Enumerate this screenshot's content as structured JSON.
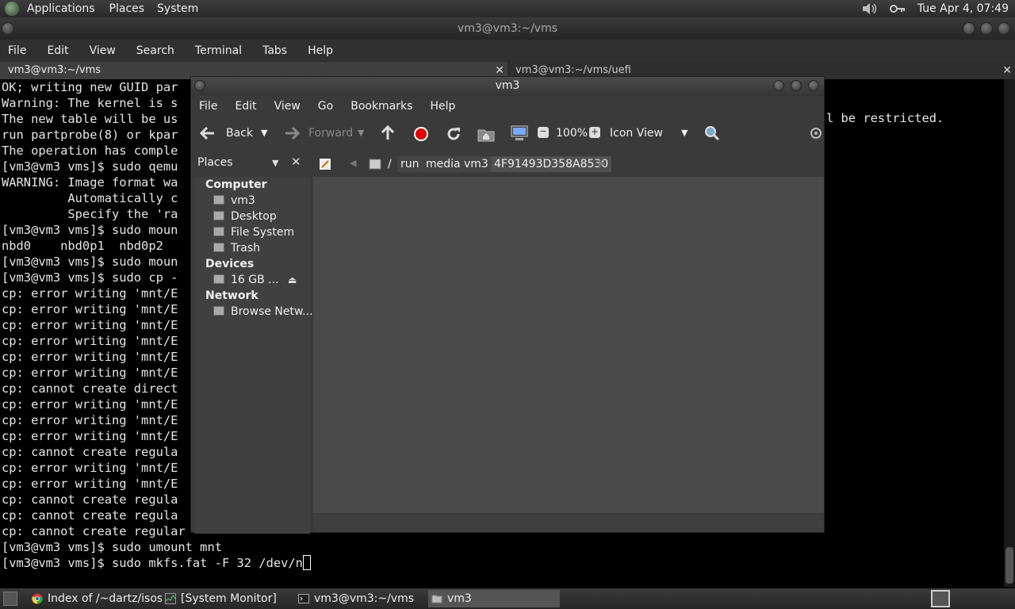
{
  "top_panel": {
    "menus": [
      "Applications",
      "Places",
      "System"
    ],
    "clock": "Tue Apr  4, 07:49"
  },
  "terminal": {
    "title": "vm3@vm3:~/vms",
    "menus": [
      "File",
      "Edit",
      "View",
      "Search",
      "Terminal",
      "Tabs",
      "Help"
    ],
    "tabs": [
      {
        "label": "vm3@vm3:~/vms"
      },
      {
        "label": "vm3@vm3:~/vms/uefi"
      }
    ],
    "lines": [
      "OK; writing new GUID par",
      "Warning: The kernel is s",
      "The new table will be us",
      "run partprobe(8) or kpar",
      "The operation has comple",
      "[vm3@vm3 vms]$ sudo qemu",
      "WARNING: Image format wa",
      "         Automatically c",
      "         Specify the 'ra",
      "[vm3@vm3 vms]$ sudo moun",
      "nbd0    nbd0p1  nbd0p2",
      "[vm3@vm3 vms]$ sudo moun",
      "[vm3@vm3 vms]$ sudo cp -",
      "cp: error writing 'mnt/E",
      "cp: error writing 'mnt/E",
      "cp: error writing 'mnt/E",
      "cp: error writing 'mnt/E",
      "cp: error writing 'mnt/E",
      "cp: error writing 'mnt/E",
      "cp: cannot create direct",
      "cp: error writing 'mnt/E",
      "cp: error writing 'mnt/E",
      "cp: error writing 'mnt/E",
      "cp: cannot create regula",
      "cp: error writing 'mnt/E",
      "cp: error writing 'mnt/E",
      "cp: cannot create regula",
      "cp: cannot create regula",
      "cp: cannot create regular",
      "[vm3@vm3 vms]$ sudo umount mnt",
      "[vm3@vm3 vms]$ sudo mkfs.fat -F 32 /dev/n"
    ],
    "restricted_fragment": "l be restricted."
  },
  "file_manager": {
    "title": "vm3",
    "menus": [
      "File",
      "Edit",
      "View",
      "Go",
      "Bookmarks",
      "Help"
    ],
    "toolbar": {
      "back": "Back",
      "forward": "Forward",
      "zoom": "100%",
      "view_mode": "Icon View"
    },
    "location": {
      "crumbs": [
        "/",
        "run",
        "media",
        "vm3",
        "4F91493D358A8530"
      ]
    },
    "sidebar": {
      "selector": "Places",
      "sections": [
        {
          "heading": "Computer",
          "items": [
            "vm3",
            "Desktop",
            "File System",
            "Trash"
          ]
        },
        {
          "heading": "Devices",
          "items": [
            "16 GB ..."
          ]
        },
        {
          "heading": "Network",
          "items": [
            "Browse Netw..."
          ]
        }
      ]
    }
  },
  "taskbar": {
    "items": [
      "Index of /~dartz/isos...",
      "[System Monitor]",
      "vm3@vm3:~/vms",
      "vm3"
    ]
  },
  "colors": {
    "panel": "#2e2e2e",
    "terminal_bg": "#000000",
    "record_button": "#e00000",
    "selected_crumb": "#505050"
  }
}
